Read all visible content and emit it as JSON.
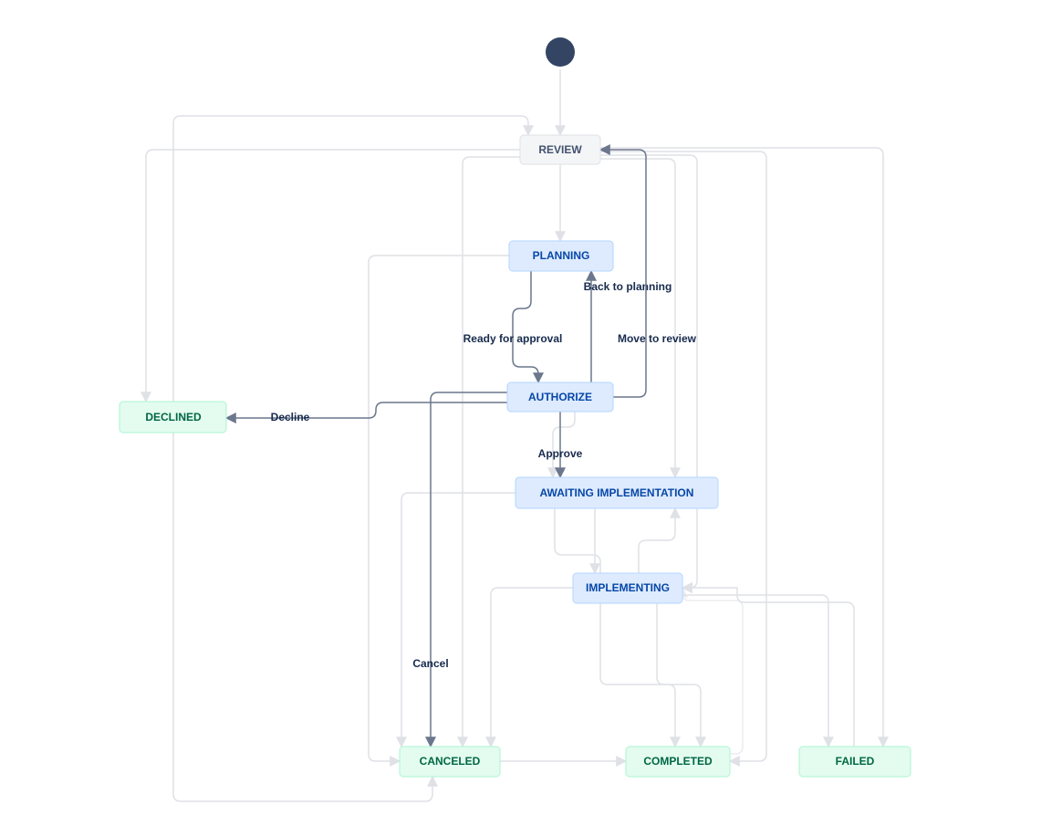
{
  "nodes": {
    "review": {
      "label": "REVIEW"
    },
    "planning": {
      "label": "PLANNING"
    },
    "authorize": {
      "label": "AUTHORIZE"
    },
    "awaiting": {
      "label": "AWAITING IMPLEMENTATION"
    },
    "implementing": {
      "label": "IMPLEMENTING"
    },
    "declined": {
      "label": "DECLINED"
    },
    "canceled": {
      "label": "CANCELED"
    },
    "completed": {
      "label": "COMPLETED"
    },
    "failed": {
      "label": "FAILED"
    }
  },
  "edge_labels": {
    "ready_for_approval": "Ready for approval",
    "back_to_planning": "Back to planning",
    "move_to_review": "Move to review",
    "approve": "Approve",
    "decline": "Decline",
    "cancel": "Cancel"
  },
  "colors": {
    "node_gray_fill": "#f4f5f7",
    "node_blue_fill": "#deebff",
    "node_green_fill": "#e3fcef",
    "edge_light": "#dfe1e6",
    "edge_dark": "#6b778c",
    "start_fill": "#344563"
  },
  "workflow": {
    "start": "review",
    "transitions": [
      {
        "from": "review",
        "to": "planning"
      },
      {
        "from": "planning",
        "to": "authorize",
        "label_key": "ready_for_approval"
      },
      {
        "from": "authorize",
        "to": "planning",
        "label_key": "back_to_planning"
      },
      {
        "from": "authorize",
        "to": "review",
        "label_key": "move_to_review"
      },
      {
        "from": "authorize",
        "to": "awaiting",
        "label_key": "approve"
      },
      {
        "from": "authorize",
        "to": "declined",
        "label_key": "decline"
      },
      {
        "from": "authorize",
        "to": "canceled",
        "label_key": "cancel"
      },
      {
        "from": "review",
        "to": "awaiting"
      },
      {
        "from": "review",
        "to": "implementing"
      },
      {
        "from": "review",
        "to": "completed"
      },
      {
        "from": "review",
        "to": "failed"
      },
      {
        "from": "review",
        "to": "canceled"
      },
      {
        "from": "review",
        "to": "declined"
      },
      {
        "from": "planning",
        "to": "canceled"
      },
      {
        "from": "awaiting",
        "to": "implementing"
      },
      {
        "from": "awaiting",
        "to": "canceled"
      },
      {
        "from": "awaiting",
        "to": "completed"
      },
      {
        "from": "implementing",
        "to": "awaiting"
      },
      {
        "from": "implementing",
        "to": "completed"
      },
      {
        "from": "implementing",
        "to": "failed"
      },
      {
        "from": "implementing",
        "to": "canceled"
      },
      {
        "from": "declined",
        "to": "review"
      },
      {
        "from": "declined",
        "to": "canceled"
      },
      {
        "from": "failed",
        "to": "implementing"
      },
      {
        "from": "completed",
        "to": "implementing"
      },
      {
        "from": "canceled",
        "to": "completed"
      }
    ]
  }
}
